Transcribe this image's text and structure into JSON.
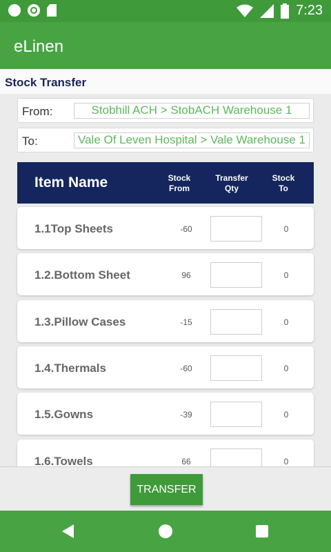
{
  "status_bar": {
    "time": "7:23"
  },
  "app": {
    "title": "eLinen"
  },
  "section": {
    "title": "Stock Transfer"
  },
  "form": {
    "from_label": "From:",
    "from_value": "Stobhill ACH > StobACH Warehouse 1",
    "to_label": "To:",
    "to_value": "Vale Of Leven Hospital > Vale Warehouse 1"
  },
  "table": {
    "headers": {
      "item_name": "Item Name",
      "stock_from": "Stock From",
      "transfer_qty": "Transfer Qty",
      "stock_to": "Stock To"
    },
    "rows": [
      {
        "name": "1.1Top Sheets",
        "stock_from": "-60",
        "transfer_qty": "",
        "stock_to": "0"
      },
      {
        "name": "1.2.Bottom Sheet",
        "stock_from": "96",
        "transfer_qty": "",
        "stock_to": "0"
      },
      {
        "name": "1.3.Pillow Cases",
        "stock_from": "-15",
        "transfer_qty": "",
        "stock_to": "0"
      },
      {
        "name": "1.4.Thermals",
        "stock_from": "-60",
        "transfer_qty": "",
        "stock_to": "0"
      },
      {
        "name": "1.5.Gowns",
        "stock_from": "-39",
        "transfer_qty": "",
        "stock_to": "0"
      },
      {
        "name": "1.6.Towels",
        "stock_from": "66",
        "transfer_qty": "",
        "stock_to": "0"
      }
    ]
  },
  "actions": {
    "transfer_label": "TRANSFER"
  },
  "icons": {
    "status_left": [
      "notification-dot-icon",
      "sync-ring-icon",
      "sd-card-icon"
    ],
    "status_right": [
      "wifi-icon",
      "cellular-signal-icon",
      "battery-icon"
    ],
    "nav": [
      "back-icon",
      "home-icon",
      "recents-icon"
    ]
  },
  "colors": {
    "primary_green": "#48a443",
    "status_green": "#3f9a3a",
    "header_navy": "#14265d",
    "field_text_green": "#5cb85c"
  }
}
